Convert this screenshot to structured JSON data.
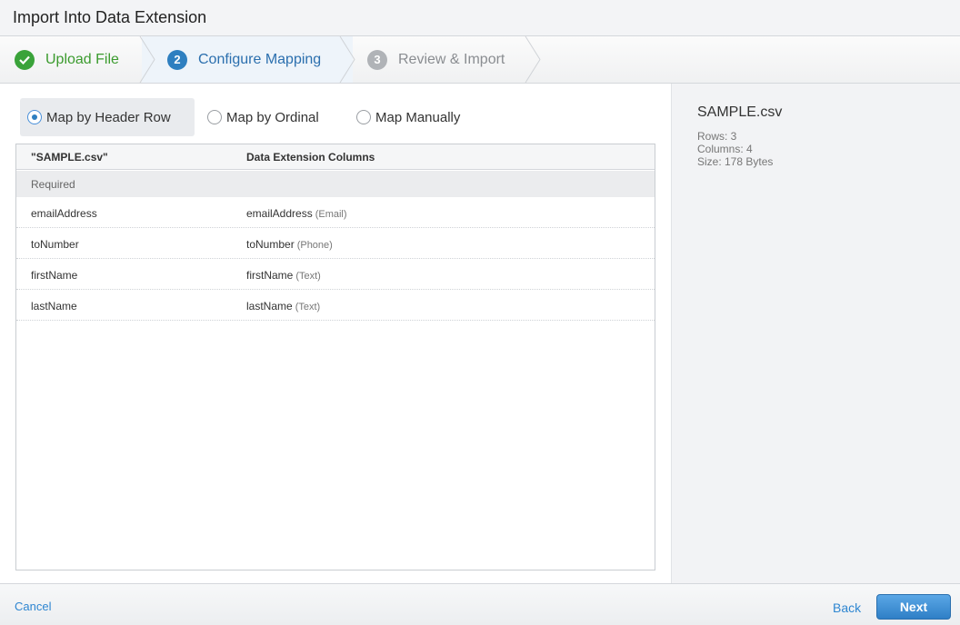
{
  "window": {
    "title": "Import Into Data Extension"
  },
  "steps": [
    {
      "number": "✓",
      "label": "Upload File",
      "state": "complete",
      "icon": "check-icon"
    },
    {
      "number": "2",
      "label": "Configure Mapping",
      "state": "active"
    },
    {
      "number": "3",
      "label": "Review & Import",
      "state": "upcoming"
    }
  ],
  "mapping_options": [
    {
      "label": "Map by Header Row",
      "selected": true
    },
    {
      "label": "Map by Ordinal",
      "selected": false
    },
    {
      "label": "Map Manually",
      "selected": false
    }
  ],
  "grid": {
    "headers": [
      "\"SAMPLE.csv\"",
      "Data Extension Columns"
    ],
    "section_label": "Required",
    "rows": [
      {
        "source": "emailAddress",
        "target": "emailAddress",
        "type": "(Email)"
      },
      {
        "source": "toNumber",
        "target": "toNumber",
        "type": "(Phone)"
      },
      {
        "source": "firstName",
        "target": "firstName",
        "type": "(Text)"
      },
      {
        "source": "lastName",
        "target": "lastName",
        "type": "(Text)"
      }
    ]
  },
  "file_info": {
    "name": "SAMPLE.csv",
    "rows": "Rows: 3",
    "columns": "Columns: 4",
    "size": "Size: 178 Bytes"
  },
  "footer": {
    "cancel": "Cancel",
    "back": "Back",
    "next": "Next"
  },
  "colors": {
    "accent": "#2e7fc0",
    "success": "#3aa33a",
    "link": "#2e86d1"
  }
}
